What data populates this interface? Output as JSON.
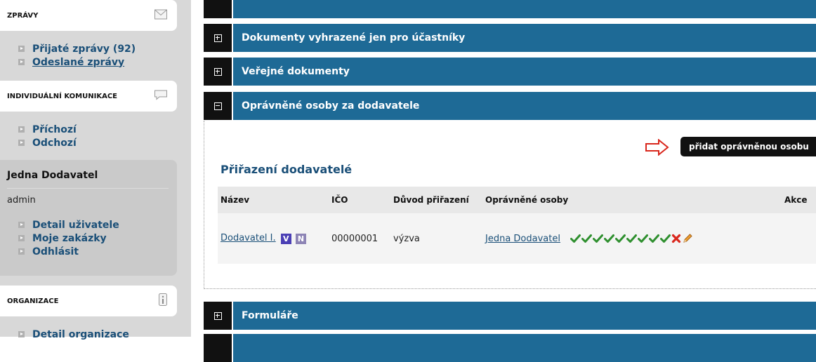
{
  "sidebar": {
    "zpravy": {
      "title": "ZPRÁVY",
      "icon": "envelope-icon",
      "items": [
        {
          "label": "Přijaté zprávy (92)"
        },
        {
          "label": "Odeslané zprávy"
        }
      ]
    },
    "komunikace": {
      "title": "INDIVIDUÁLNÍ KOMUNIKACE",
      "icon": "speech-bubble-icon",
      "items": [
        {
          "label": "Příchozí"
        },
        {
          "label": "Odchozí"
        }
      ]
    },
    "user": {
      "name": "Jedna Dodavatel",
      "role": "admin",
      "items": [
        {
          "label": "Detail uživatele"
        },
        {
          "label": "Moje zakázky"
        },
        {
          "label": "Odhlásit"
        }
      ]
    },
    "organizace": {
      "title": "ORGANIZACE",
      "icon": "info-icon",
      "items": [
        {
          "label": "Detail organizace"
        }
      ]
    }
  },
  "panels": {
    "p1": {
      "label": "Dokumenty vyhrazené jen pro účastníky"
    },
    "p2": {
      "label": "Veřejné dokumenty"
    },
    "p3": {
      "label": "Oprávněné osoby za dodavatele"
    },
    "p4": {
      "label": "Formuláře"
    }
  },
  "content": {
    "add_button": "přidat oprávněnou osobu",
    "section_title": "Přiřazení dodavatelé",
    "table": {
      "headers": [
        "Název",
        "IČO",
        "Důvod přiřazení",
        "Oprávněné osoby",
        "Akce"
      ],
      "rows": [
        {
          "name": "Dodavatel I.",
          "badge_v": "V",
          "badge_n": "N",
          "ico": "00000001",
          "reason": "výzva",
          "person": "Jedna Dodavatel"
        }
      ]
    }
  },
  "colors": {
    "accent_blue": "#1e6a96",
    "link_blue": "#1a4f78",
    "badge_v": "#4b3fb5",
    "badge_n": "#8d84b5",
    "check_green": "#2e8f2e",
    "cross_red": "#d9261c"
  }
}
